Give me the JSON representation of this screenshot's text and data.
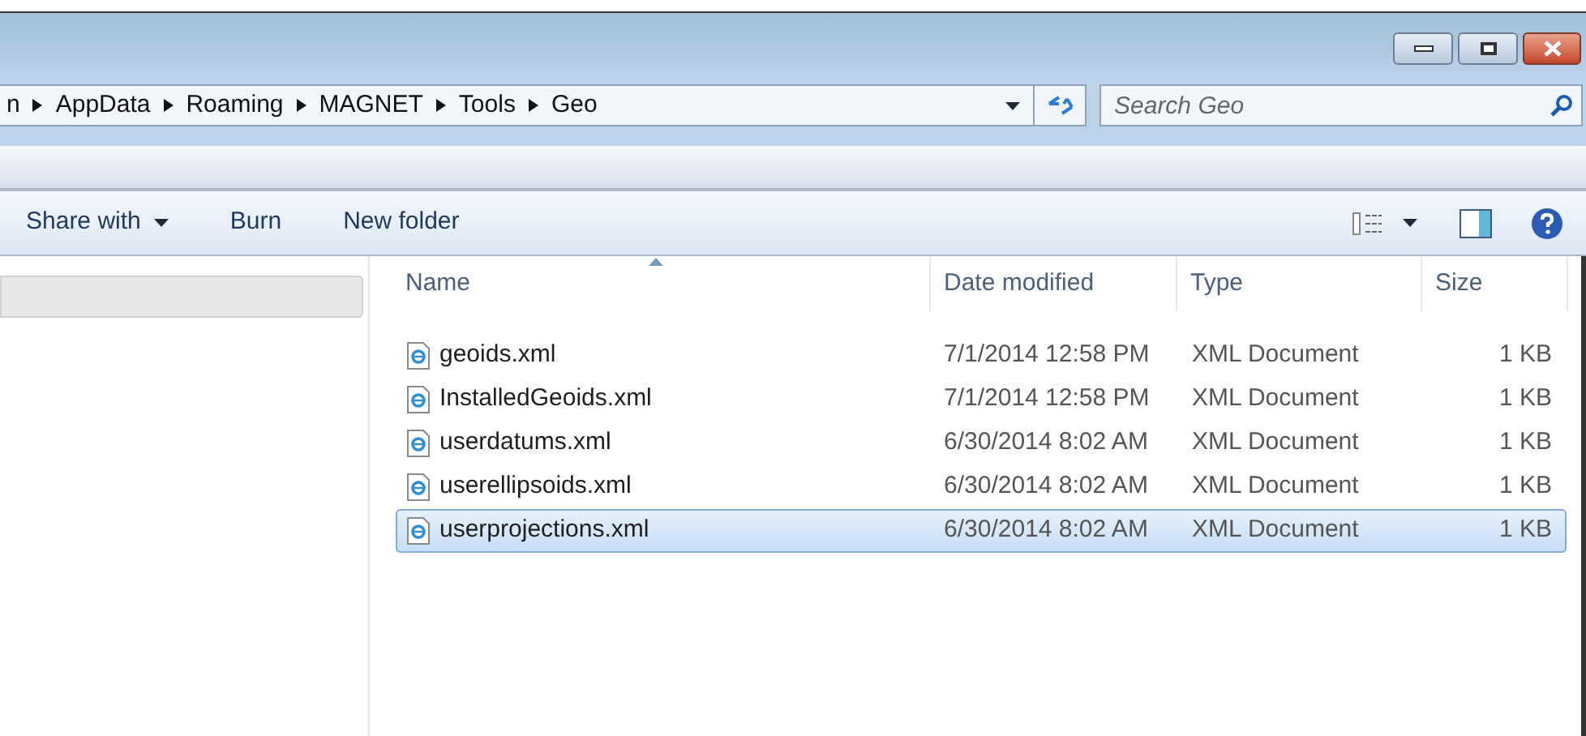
{
  "address_bar": {
    "crumbs": [
      "n",
      "AppData",
      "Roaming",
      "MAGNET",
      "Tools",
      "Geo"
    ]
  },
  "search": {
    "placeholder": "Search Geo"
  },
  "toolbar": {
    "buttons": [
      {
        "label": "Share with",
        "dropdown": true
      },
      {
        "label": "Burn",
        "dropdown": false
      },
      {
        "label": "New folder",
        "dropdown": false
      }
    ]
  },
  "table": {
    "columns": [
      "Name",
      "Date modified",
      "Type",
      "Size"
    ],
    "rows": [
      {
        "name": "geoids.xml",
        "date": "7/1/2014 12:58 PM",
        "type": "XML Document",
        "size": "1 KB",
        "selected": false
      },
      {
        "name": "InstalledGeoids.xml",
        "date": "7/1/2014 12:58 PM",
        "type": "XML Document",
        "size": "1 KB",
        "selected": false
      },
      {
        "name": "userdatums.xml",
        "date": "6/30/2014 8:02 AM",
        "type": "XML Document",
        "size": "1 KB",
        "selected": false
      },
      {
        "name": "userellipsoids.xml",
        "date": "6/30/2014 8:02 AM",
        "type": "XML Document",
        "size": "1 KB",
        "selected": false
      },
      {
        "name": "userprojections.xml",
        "date": "6/30/2014 8:02 AM",
        "type": "XML Document",
        "size": "1 KB",
        "selected": true
      }
    ]
  }
}
